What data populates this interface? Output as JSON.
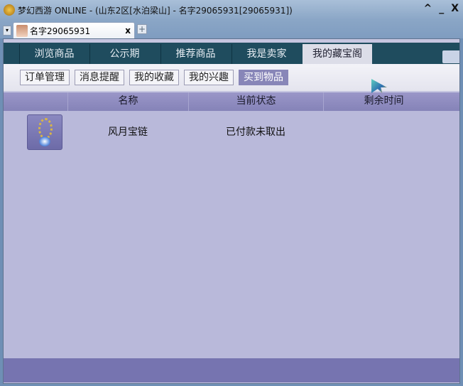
{
  "window": {
    "title": "梦幻西游 ONLINE - (山东2区[水泊梁山] - 名字29065931[29065931])",
    "controls": [
      "^",
      "_",
      "X"
    ]
  },
  "doc_tab": {
    "label": "名字29065931",
    "close": "x",
    "add": "+"
  },
  "nav": {
    "items": [
      "浏览商品",
      "公示期",
      "推荐商品",
      "我是卖家",
      "我的藏宝阁"
    ],
    "active": 4
  },
  "subnav": {
    "items": [
      "订单管理",
      "消息提醒",
      "我的收藏",
      "我的兴趣",
      "买到物品"
    ],
    "active": 4
  },
  "table": {
    "headers": [
      "名称",
      "当前状态",
      "剩余时间"
    ],
    "rows": [
      {
        "name": "风月宝链",
        "status": "已付款未取出",
        "remaining": "",
        "icon": "necklace-icon"
      }
    ]
  },
  "colors": {
    "nav_bg": "#1f4c5e",
    "header_bg": "#8a86bb",
    "body_bg": "#b9b9da",
    "footer_bg": "#7674b0"
  }
}
